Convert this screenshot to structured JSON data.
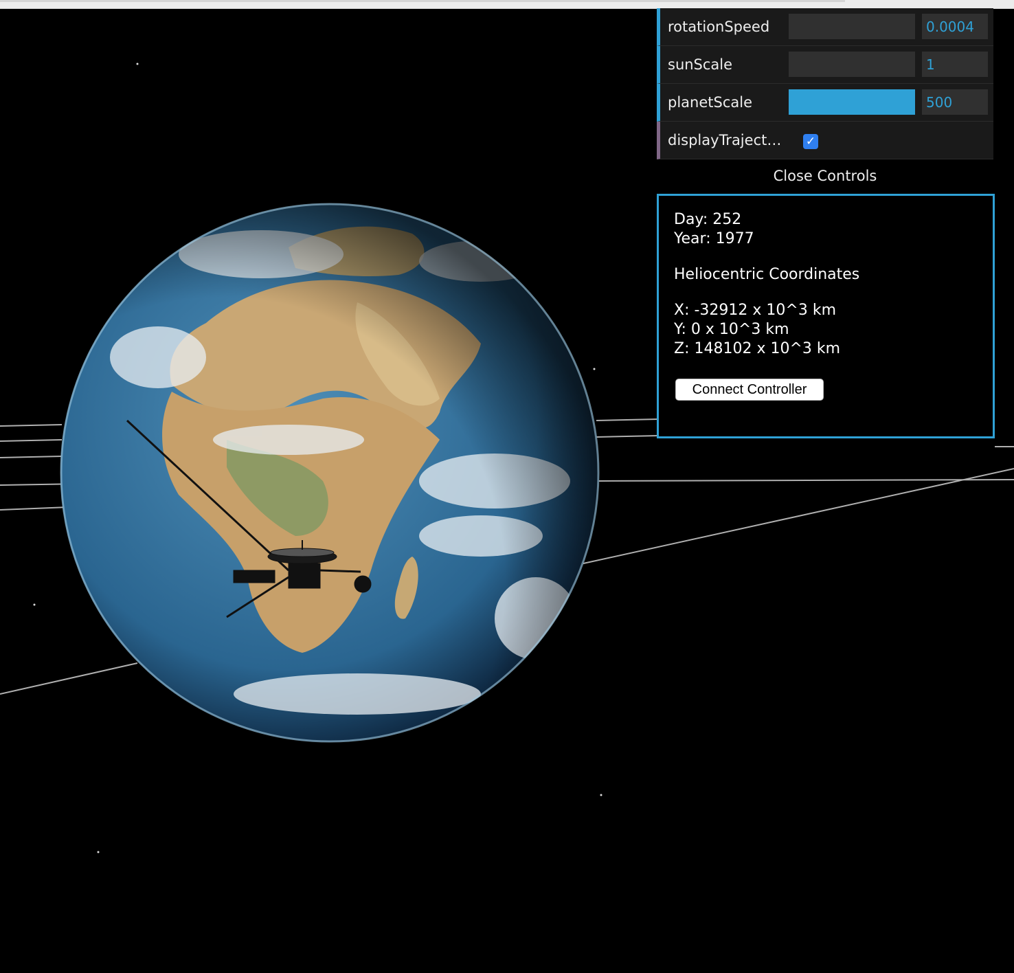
{
  "controls": [
    {
      "label": "rotationSpeed",
      "value": "0.0004",
      "fill": 0.0
    },
    {
      "label": "sunScale",
      "value": "1",
      "fill": 0.0
    },
    {
      "label": "planetScale",
      "value": "500",
      "fill": 1.0
    }
  ],
  "display_trajectory": {
    "label": "displayTrajecto...",
    "checked": true
  },
  "close_controls": "Close Controls",
  "info": {
    "day": "Day: 252",
    "year": "Year: 1977",
    "heading": "Heliocentric Coordinates",
    "x": "X: -32912 x 10^3 km",
    "y": "Y: 0 x 10^3 km",
    "z": "Z: 148102 x 10^3 km",
    "connect_button": "Connect Controller"
  },
  "colors": {
    "accent": "#2fa1d6",
    "bool_accent": "#806787",
    "background": "#000000"
  },
  "icons": {
    "checkbox": "check-icon"
  }
}
